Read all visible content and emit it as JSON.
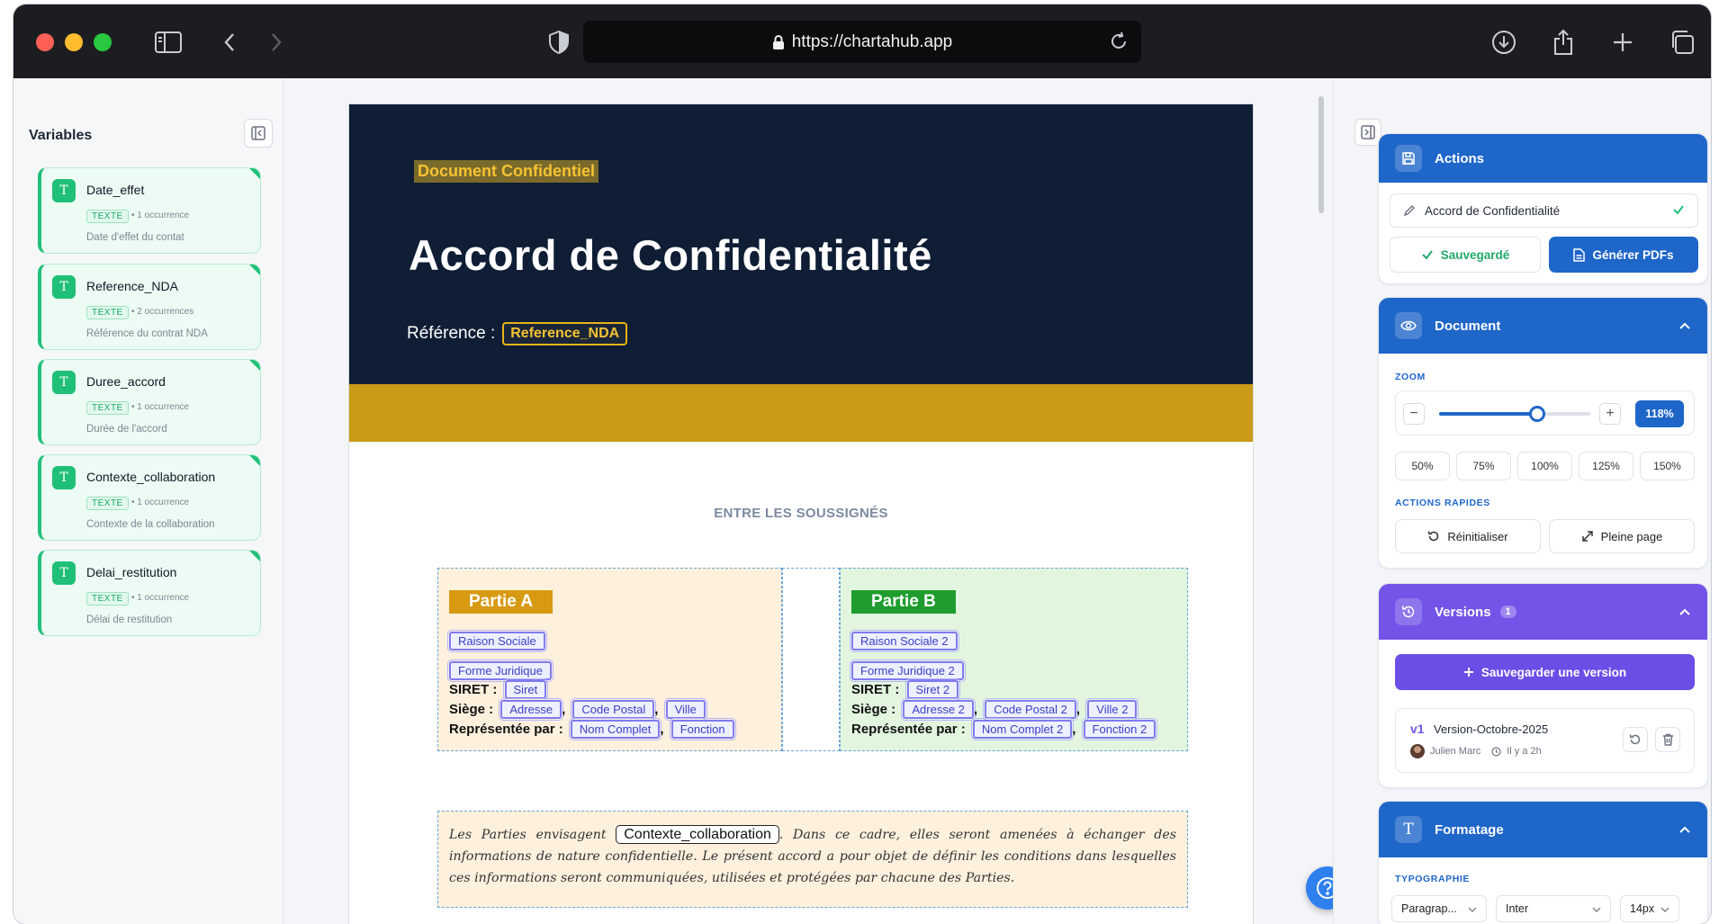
{
  "browser": {
    "url": "https://chartahub.app",
    "traffic_lights": [
      "#ff5f57",
      "#febc2e",
      "#28c840"
    ]
  },
  "left_panel": {
    "title": "Variables",
    "variables": [
      {
        "badge": "T",
        "name": "Date_effet",
        "type": "TEXTE",
        "occurrences": "• 1 occurrence",
        "description": "Date d'effet du contat"
      },
      {
        "badge": "T",
        "name": "Reference_NDA",
        "type": "TEXTE",
        "occurrences": "• 2 occurrences",
        "description": "Référence du contrat NDA"
      },
      {
        "badge": "T",
        "name": "Duree_accord",
        "type": "TEXTE",
        "occurrences": "• 1 occurrence",
        "description": "Durée de l'accord"
      },
      {
        "badge": "T",
        "name": "Contexte_collaboration",
        "type": "TEXTE",
        "occurrences": "• 1 occurrence",
        "description": "Contexte de la collaboration"
      },
      {
        "badge": "T",
        "name": "Delai_restitution",
        "type": "TEXTE",
        "occurrences": "• 1 occurrence",
        "description": "Délai de restitution"
      }
    ]
  },
  "document": {
    "confidential_tag": "Document Confidentiel",
    "title": "Accord de Confidentialité",
    "reference_label": "Référence :",
    "reference_var": "Reference_NDA",
    "between": "ENTRE LES SOUSSIGNÉS",
    "party_a": {
      "label": "Partie A",
      "raison": "Raison Sociale",
      "forme": "Forme Juridique",
      "siret_label": "SIRET :",
      "siret": "Siret",
      "siege_label": "Siège :",
      "adresse": "Adresse",
      "cp": "Code Postal",
      "ville": "Ville",
      "rep_label": "Représentée par :",
      "nom": "Nom Complet",
      "fonction": "Fonction"
    },
    "party_b": {
      "label": "Partie B",
      "raison": "Raison Sociale 2",
      "forme": "Forme Juridique 2",
      "siret_label": "SIRET :",
      "siret": "Siret 2",
      "siege_label": "Siège :",
      "adresse": "Adresse 2",
      "cp": "Code Postal 2",
      "ville": "Ville 2",
      "rep_label": "Représentée par :",
      "nom": "Nom Complet 2",
      "fonction": "Fonction 2"
    },
    "comma": ",",
    "intro_before": "Les Parties envisagent",
    "intro_var": "Contexte_collaboration",
    "intro_after": ". Dans ce cadre, elles seront amenées à échanger des informations de nature confidentielle. Le présent accord a pour objet de définir les conditions dans lesquelles ces informations seront communiquées, utilisées et protégées par chacune des Parties."
  },
  "right_panel": {
    "actions": {
      "title": "Actions",
      "doc_name": "Accord de Confidentialité",
      "saved_label": "Sauvegardé",
      "generate_label": "Générer PDFs"
    },
    "document": {
      "title": "Document",
      "zoom_label": "ZOOM",
      "zoom_value": "118%",
      "zoom_fraction": 0.65,
      "minus": "−",
      "plus": "+",
      "presets": [
        "50%",
        "75%",
        "100%",
        "125%",
        "150%"
      ],
      "quick_label": "ACTIONS RAPIDES",
      "reset_label": "Réinitialiser",
      "fullpage_label": "Pleine page"
    },
    "versions": {
      "title": "Versions",
      "count": "1",
      "save_label": "Sauvegarder une version",
      "items": [
        {
          "tag": "v1",
          "name": "Version-Octobre-2025",
          "author": "Julien Marc",
          "time": "Il y a 2h"
        }
      ]
    },
    "formatting": {
      "title": "Formatage",
      "typo_label": "TYPOGRAPHIE",
      "style": "Paragrap...",
      "font": "Inter",
      "size": "14px"
    }
  },
  "colors": {
    "accent": "#1f66c9",
    "versions": "#7353e8",
    "variable_green": "#22c07a",
    "doc_header": "#0f1e35",
    "gold": "#c99a16"
  }
}
